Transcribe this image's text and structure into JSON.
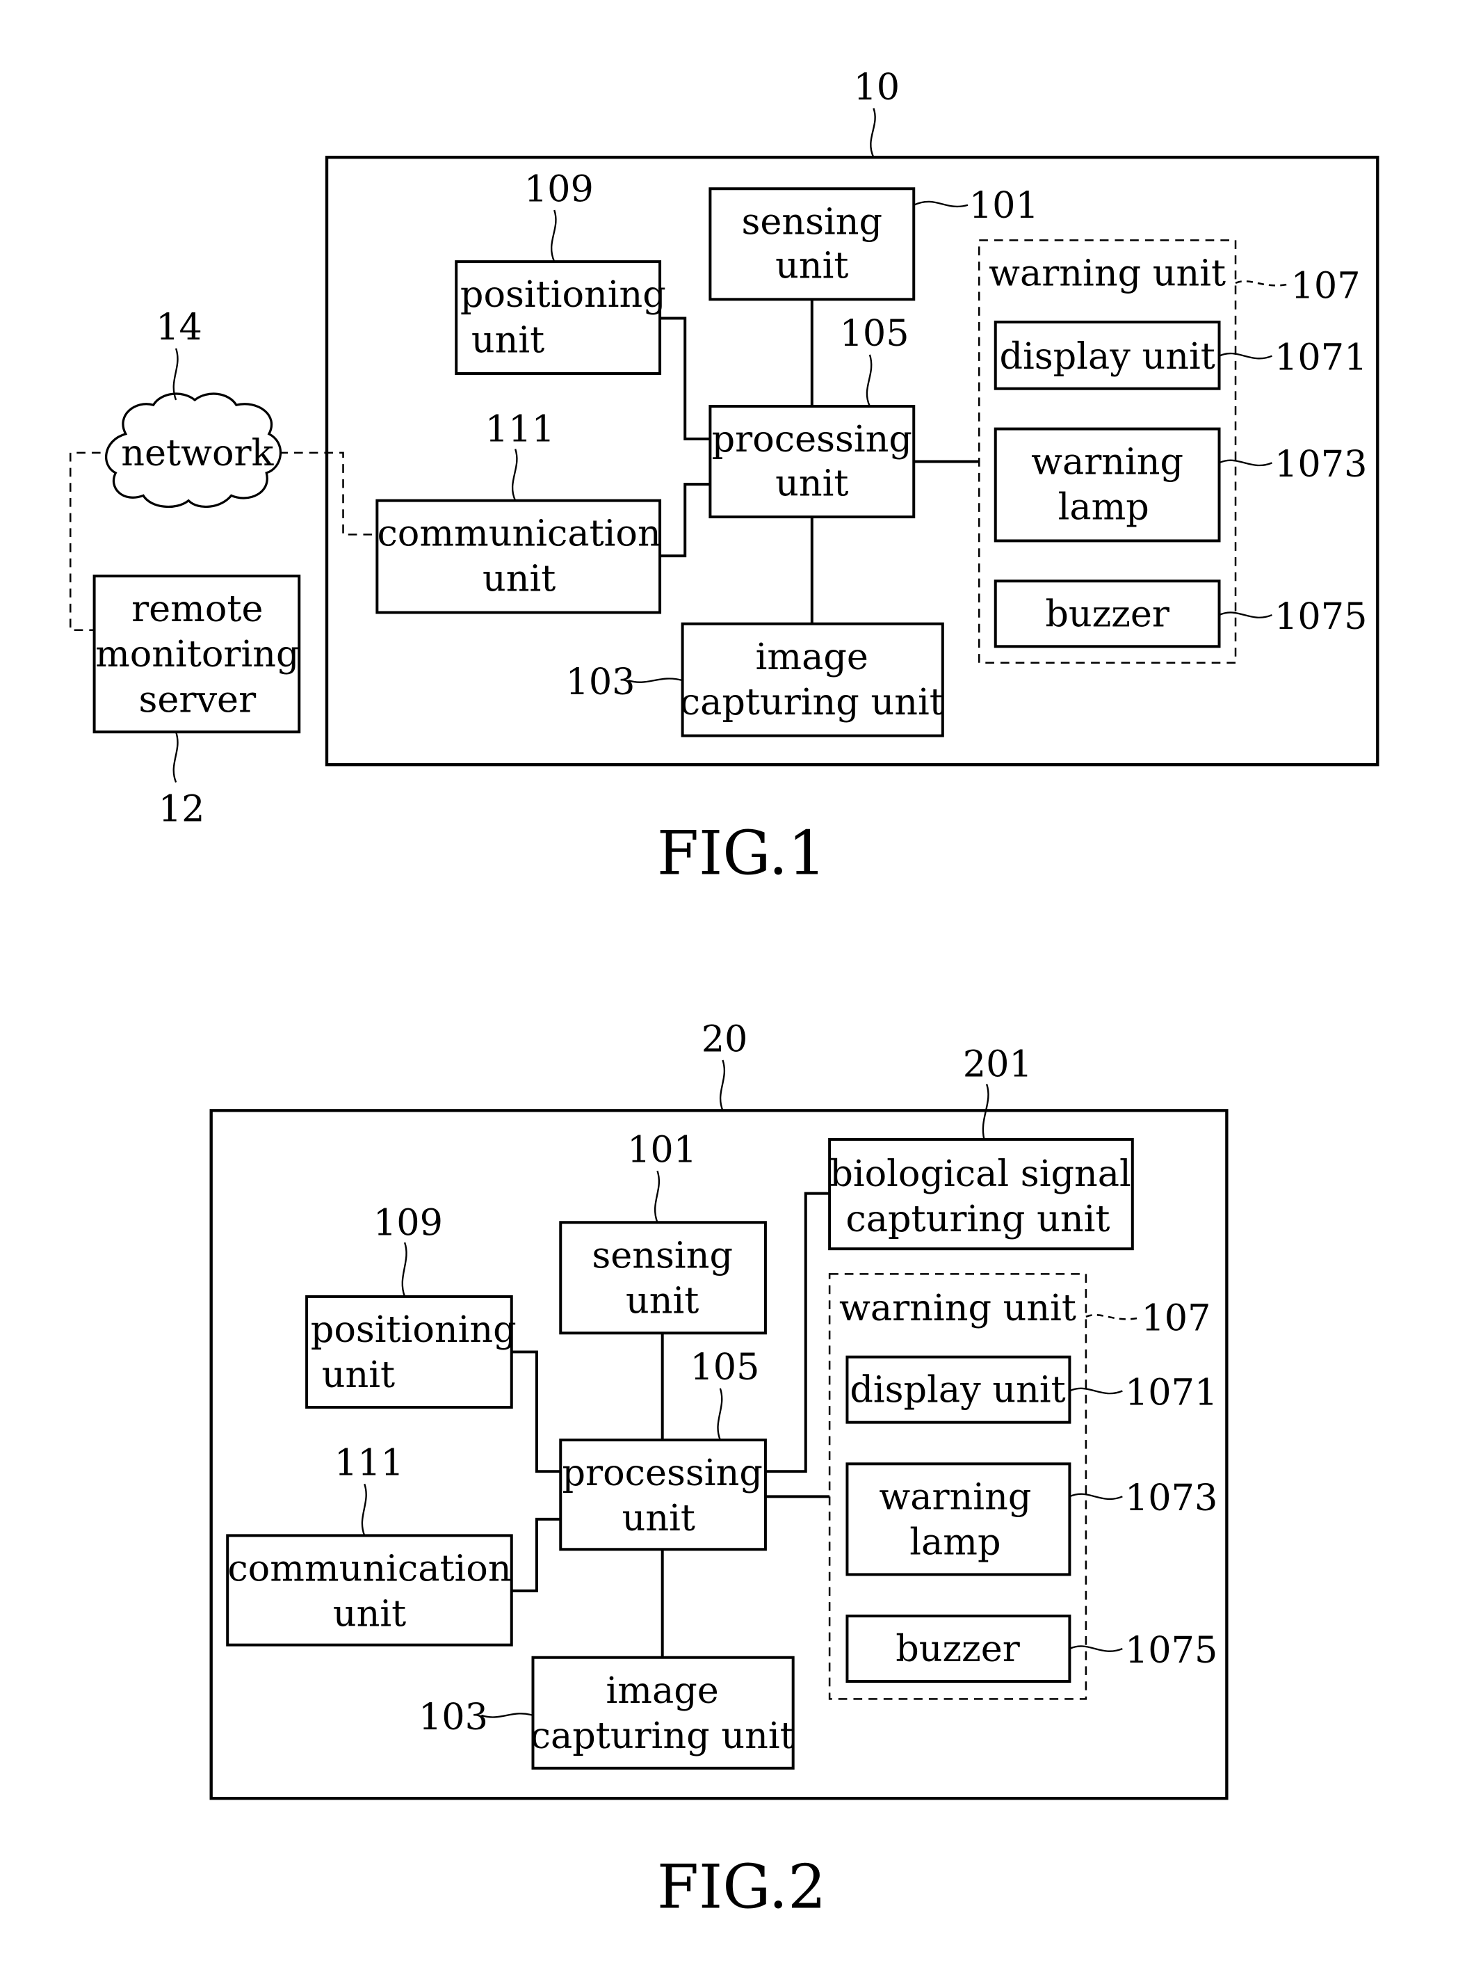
{
  "fig1": {
    "caption": "FIG.1",
    "system_ref": "10",
    "network": {
      "label": "network",
      "ref": "14"
    },
    "server": {
      "lines": [
        "remote",
        "monitoring",
        "server"
      ],
      "ref": "12"
    },
    "sensing": {
      "lines": [
        "sensing",
        "unit"
      ],
      "ref": "101"
    },
    "positioning": {
      "lines": [
        "positioning",
        "unit"
      ],
      "ref": "109"
    },
    "processing": {
      "lines": [
        "processing",
        "unit"
      ],
      "ref": "105"
    },
    "communication": {
      "lines": [
        "communication",
        "unit"
      ],
      "ref": "111"
    },
    "image": {
      "lines": [
        "image",
        "capturing unit"
      ],
      "ref": "103"
    },
    "warning": {
      "label": "warning unit",
      "ref": "107"
    },
    "display": {
      "label": "display unit",
      "ref": "1071"
    },
    "lamp": {
      "lines": [
        "warning",
        "lamp"
      ],
      "ref": "1073"
    },
    "buzzer": {
      "label": "buzzer",
      "ref": "1075"
    }
  },
  "fig2": {
    "caption": "FIG.2",
    "system_ref": "20",
    "bio": {
      "lines": [
        "biological signal",
        "capturing unit"
      ],
      "ref": "201"
    },
    "sensing": {
      "lines": [
        "sensing",
        "unit"
      ],
      "ref": "101"
    },
    "positioning": {
      "lines": [
        "positioning",
        "unit"
      ],
      "ref": "109"
    },
    "processing": {
      "lines": [
        "processing",
        "unit"
      ],
      "ref": "105"
    },
    "communication": {
      "lines": [
        "communication",
        "unit"
      ],
      "ref": "111"
    },
    "image": {
      "lines": [
        "image",
        "capturing unit"
      ],
      "ref": "103"
    },
    "warning": {
      "label": "warning unit",
      "ref": "107"
    },
    "display": {
      "label": "display unit",
      "ref": "1071"
    },
    "lamp": {
      "lines": [
        "warning",
        "lamp"
      ],
      "ref": "1073"
    },
    "buzzer": {
      "label": "buzzer",
      "ref": "1075"
    }
  }
}
